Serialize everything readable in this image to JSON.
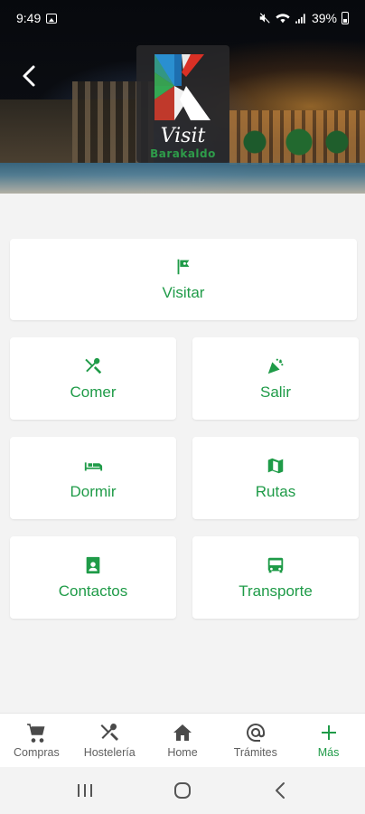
{
  "status_bar": {
    "time": "9:49",
    "battery": "39%"
  },
  "logo": {
    "visit_text": "Visit",
    "city_text": "Barakaldo"
  },
  "menu": {
    "visitar": "Visitar",
    "comer": "Comer",
    "salir": "Salir",
    "dormir": "Dormir",
    "rutas": "Rutas",
    "contactos": "Contactos",
    "transporte": "Transporte"
  },
  "bottom_nav": {
    "items": [
      {
        "label": "Compras",
        "icon": "cart-icon"
      },
      {
        "label": "Hostelería",
        "icon": "utensils-icon"
      },
      {
        "label": "Home",
        "icon": "home-icon"
      },
      {
        "label": "Trámites",
        "icon": "at-icon"
      },
      {
        "label": "Más",
        "icon": "plus-icon",
        "active": true
      }
    ]
  },
  "colors": {
    "accent": "#1f9b48",
    "background": "#f3f3f3"
  }
}
